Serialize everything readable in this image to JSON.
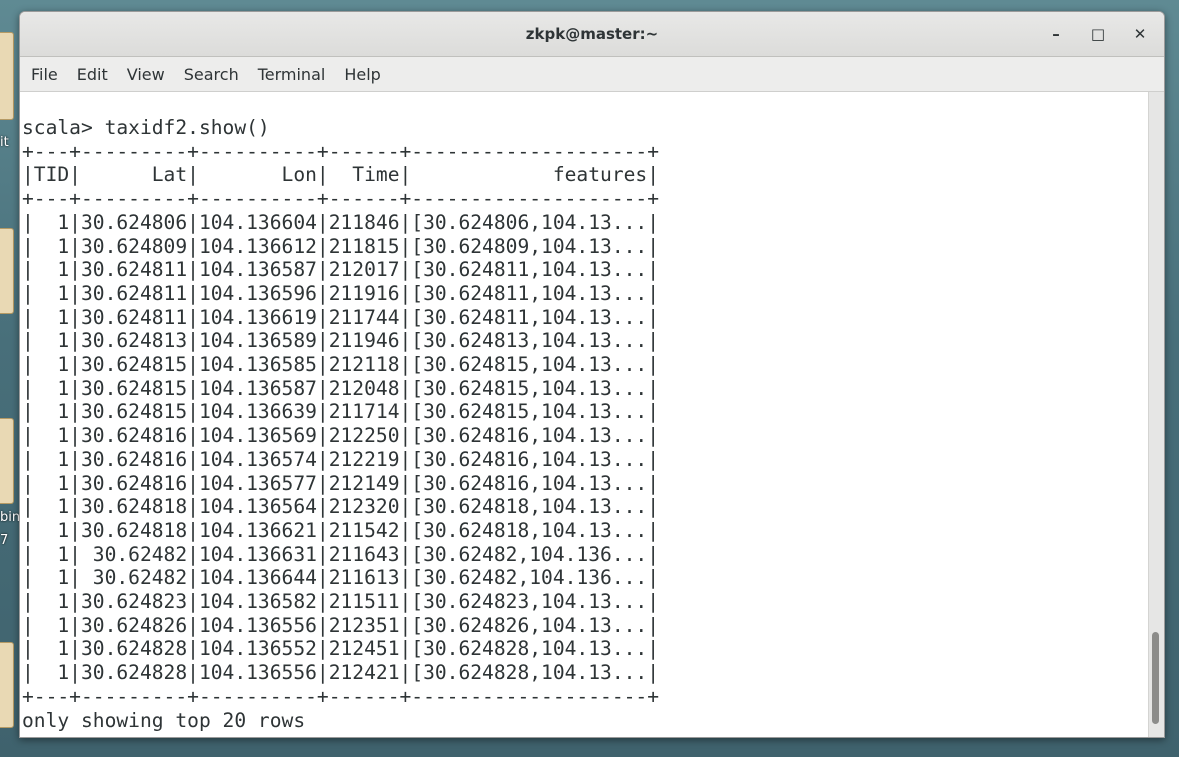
{
  "window": {
    "title": "zkpk@master:~",
    "controls": {
      "minimize": "–",
      "maximize": "□",
      "close": "✕"
    }
  },
  "menu": [
    "File",
    "Edit",
    "View",
    "Search",
    "Terminal",
    "Help"
  ],
  "desktop": {
    "labels": [
      "it",
      "bin",
      "7"
    ]
  },
  "terminal": {
    "prompt": "scala> taxidf2.show()",
    "border": "+---+---------+----------+------+--------------------+",
    "header": "|TID|      Lat|       Lon|  Time|            features|",
    "rows": [
      "|  1|30.624806|104.136604|211846|[30.624806,104.13...|",
      "|  1|30.624809|104.136612|211815|[30.624809,104.13...|",
      "|  1|30.624811|104.136587|212017|[30.624811,104.13...|",
      "|  1|30.624811|104.136596|211916|[30.624811,104.13...|",
      "|  1|30.624811|104.136619|211744|[30.624811,104.13...|",
      "|  1|30.624813|104.136589|211946|[30.624813,104.13...|",
      "|  1|30.624815|104.136585|212118|[30.624815,104.13...|",
      "|  1|30.624815|104.136587|212048|[30.624815,104.13...|",
      "|  1|30.624815|104.136639|211714|[30.624815,104.13...|",
      "|  1|30.624816|104.136569|212250|[30.624816,104.13...|",
      "|  1|30.624816|104.136574|212219|[30.624816,104.13...|",
      "|  1|30.624816|104.136577|212149|[30.624816,104.13...|",
      "|  1|30.624818|104.136564|212320|[30.624818,104.13...|",
      "|  1|30.624818|104.136621|211542|[30.624818,104.13...|",
      "|  1| 30.62482|104.136631|211643|[30.62482,104.136...|",
      "|  1| 30.62482|104.136644|211613|[30.62482,104.136...|",
      "|  1|30.624823|104.136582|211511|[30.624823,104.13...|",
      "|  1|30.624826|104.136556|212351|[30.624826,104.13...|",
      "|  1|30.624828|104.136552|212451|[30.624828,104.13...|",
      "|  1|30.624828|104.136556|212421|[30.624828,104.13...|"
    ],
    "footer": "only showing top 20 rows"
  },
  "colors": {
    "text": "#2e3436",
    "background": "#ffffff",
    "titlebar": "#e0e0de"
  }
}
